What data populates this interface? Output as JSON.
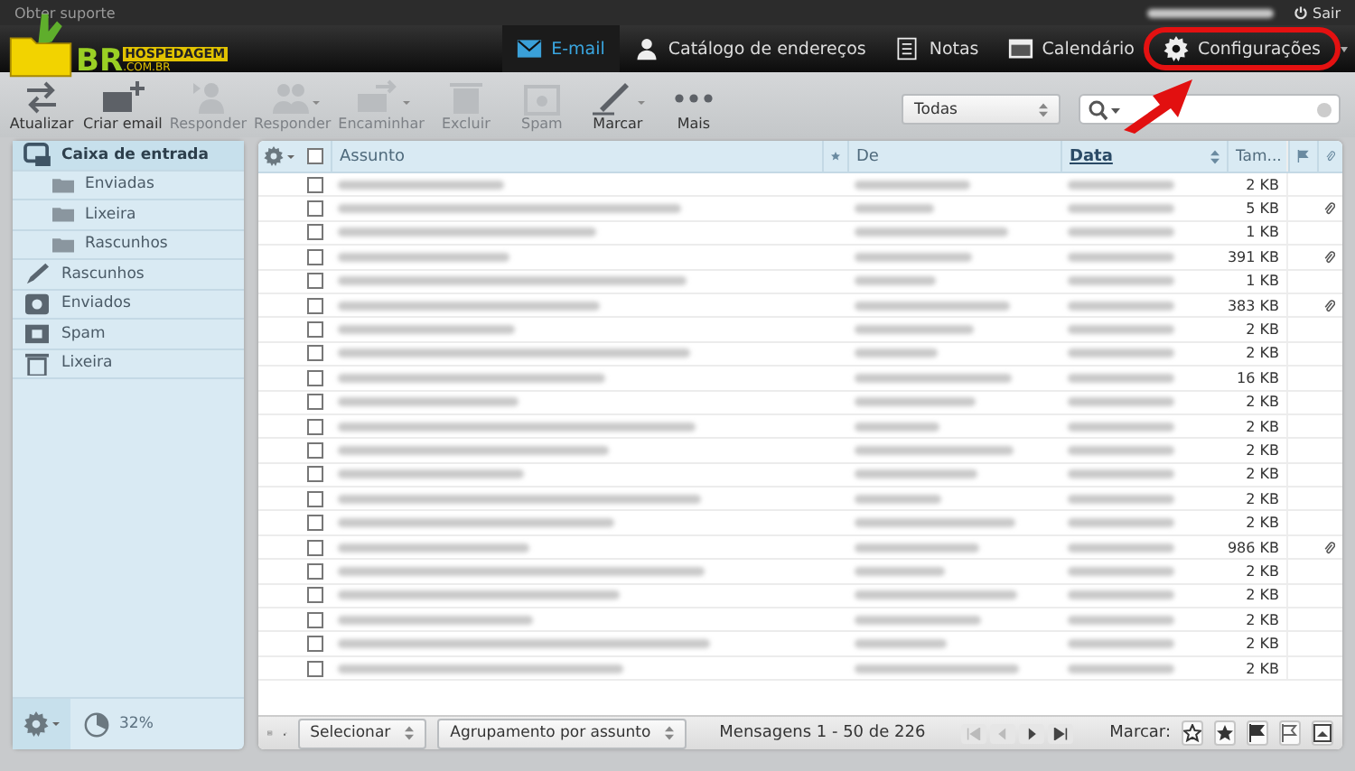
{
  "topbar": {
    "support": "Obter suporte",
    "logout": "Sair"
  },
  "logo": {
    "mark": "BR",
    "name": "HOSPEDAGEM",
    "domain": ".COM.BR"
  },
  "nav": [
    {
      "label": "E-mail",
      "kind": "mail",
      "selected": true,
      "highlighted": false
    },
    {
      "label": "Catálogo de endereços",
      "kind": "contacts",
      "selected": false,
      "highlighted": false
    },
    {
      "label": "Notas",
      "kind": "notes",
      "selected": false,
      "highlighted": false
    },
    {
      "label": "Calendário",
      "kind": "calendar",
      "selected": false,
      "highlighted": false
    },
    {
      "label": "Configurações",
      "kind": "settings",
      "selected": false,
      "highlighted": true
    }
  ],
  "toolbar": [
    {
      "label": "Atualizar",
      "kind": "refresh",
      "disabled": false,
      "dropdown": false
    },
    {
      "label": "Criar email",
      "kind": "compose",
      "disabled": false,
      "dropdown": false
    },
    {
      "label": "Responder",
      "kind": "reply",
      "disabled": true,
      "dropdown": false
    },
    {
      "label": "Responder",
      "kind": "reply-all",
      "disabled": true,
      "dropdown": true
    },
    {
      "label": "Encaminhar",
      "kind": "forward",
      "disabled": true,
      "dropdown": true
    },
    {
      "label": "Excluir",
      "kind": "delete",
      "disabled": true,
      "dropdown": false
    },
    {
      "label": "Spam",
      "kind": "spam",
      "disabled": true,
      "dropdown": false
    },
    {
      "label": "Marcar",
      "kind": "mark",
      "disabled": false,
      "dropdown": true
    },
    {
      "label": "Mais",
      "kind": "more",
      "disabled": false,
      "dropdown": false
    }
  ],
  "filter": {
    "value": "Todas"
  },
  "select_all": {
    "checked": false
  },
  "folders": [
    {
      "label": "Caixa de entrada",
      "kind": "inbox",
      "selected": true,
      "children": [
        {
          "label": "Enviadas",
          "kind": "folder",
          "selected": false
        },
        {
          "label": "Lixeira",
          "kind": "folder",
          "selected": false
        },
        {
          "label": "Rascunhos",
          "kind": "folder",
          "selected": false
        }
      ]
    },
    {
      "label": "Rascunhos",
      "kind": "drafts",
      "selected": false
    },
    {
      "label": "Enviados",
      "kind": "sent",
      "selected": false
    },
    {
      "label": "Spam",
      "kind": "spam",
      "selected": false
    },
    {
      "label": "Lixeira",
      "kind": "trash",
      "selected": false
    }
  ],
  "quota": {
    "text": "32%",
    "level": 0.32
  },
  "columns": [
    {
      "label": "Assunto",
      "kind": "subject",
      "sorted": false
    },
    {
      "kind": "star",
      "sorted": false
    },
    {
      "label": "De",
      "kind": "from",
      "sorted": false
    },
    {
      "label": "Data",
      "kind": "date",
      "sorted": true
    },
    {
      "label": "Tam...",
      "kind": "size",
      "sorted": false
    },
    {
      "kind": "flag",
      "sorted": false
    },
    {
      "kind": "attachment",
      "sorted": false
    }
  ],
  "messages": [
    {
      "size": "2 KB",
      "attachment": false,
      "checked": false
    },
    {
      "size": "5 KB",
      "attachment": true,
      "checked": false
    },
    {
      "size": "1 KB",
      "attachment": false,
      "checked": false
    },
    {
      "size": "391 KB",
      "attachment": true,
      "checked": false
    },
    {
      "size": "1 KB",
      "attachment": false,
      "checked": false
    },
    {
      "size": "383 KB",
      "attachment": true,
      "checked": false
    },
    {
      "size": "2 KB",
      "attachment": false,
      "checked": false
    },
    {
      "size": "2 KB",
      "attachment": false,
      "checked": false
    },
    {
      "size": "16 KB",
      "attachment": false,
      "checked": false
    },
    {
      "size": "2 KB",
      "attachment": false,
      "checked": false
    },
    {
      "size": "2 KB",
      "attachment": false,
      "checked": false
    },
    {
      "size": "2 KB",
      "attachment": false,
      "checked": false
    },
    {
      "size": "2 KB",
      "attachment": false,
      "checked": false
    },
    {
      "size": "2 KB",
      "attachment": false,
      "checked": false
    },
    {
      "size": "2 KB",
      "attachment": false,
      "checked": false
    },
    {
      "size": "986 KB",
      "attachment": true,
      "checked": false
    },
    {
      "size": "2 KB",
      "attachment": false,
      "checked": false
    },
    {
      "size": "2 KB",
      "attachment": false,
      "checked": false
    },
    {
      "size": "2 KB",
      "attachment": false,
      "checked": false
    },
    {
      "size": "2 KB",
      "attachment": false,
      "checked": false
    },
    {
      "size": "2 KB",
      "attachment": false,
      "checked": false
    }
  ],
  "footer": {
    "select": "Selecionar",
    "threading": "Agrupamento por assunto",
    "count": "Mensagens 1 - 50 de 226",
    "pager": [
      {
        "kind": "first",
        "disabled": true
      },
      {
        "kind": "prev",
        "disabled": true
      },
      {
        "kind": "next",
        "disabled": false
      },
      {
        "kind": "last",
        "disabled": false
      }
    ],
    "mark_label": "Marcar:"
  }
}
